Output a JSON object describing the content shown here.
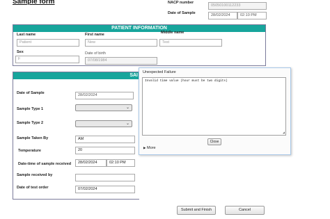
{
  "header": {
    "title": "Sample form",
    "nacp_label": "NACP number",
    "nacp_value": "05050100112233",
    "date_label": "Date of Sample",
    "date_value": "28/02/2024",
    "time_value": "02:10 PM"
  },
  "patient": {
    "heading": "PATIENT INFORMATION",
    "last_name_label": "Last name",
    "last_name_value": "Patient",
    "first_name_label": "First name",
    "first_name_value": "New",
    "middle_name_label": "Middle name",
    "middle_name_value": "Test",
    "sex_label": "Sex",
    "sex_value": "F",
    "dob_label": "Date of birth",
    "dob_value": "07/08/1984"
  },
  "sample": {
    "heading_visible": "SAI",
    "date_label": "Date of Sample",
    "date_value": "28/02/2024",
    "type1_label": "Sample Type 1",
    "type2_label": "Sample Type 2",
    "taken_by_label": "Sample Taken By",
    "taken_by_value": "AM",
    "temperature_label": "Temperature",
    "temperature_value": "20",
    "datetime_received_label": "Date-time of sample received",
    "received_date_value": "28/02/2024",
    "received_time_value": "02:10 PM",
    "received_by_label": "Sample received by",
    "test_order_label": "Date of test order",
    "test_order_value": "07/02/2024"
  },
  "dialog": {
    "title": "Unexpected Failure",
    "message": "Invalid time value (hour must be two digits)",
    "close_label": "Close",
    "more_label": "More",
    "more_icon": "triangle-right-icon"
  },
  "footer": {
    "submit_label": "Submit and Finish",
    "cancel_label": "Cancel"
  },
  "colors": {
    "accent": "#17a59c",
    "dialog_border": "#a8c8e8"
  }
}
